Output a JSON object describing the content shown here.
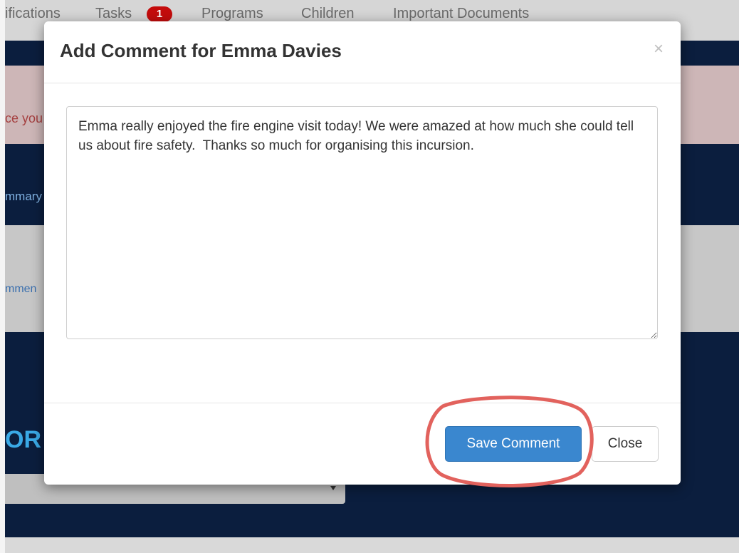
{
  "background": {
    "nav": {
      "items": [
        "ifications",
        "Tasks",
        "Programs",
        "Children",
        "Important Documents"
      ],
      "tasks_badge": "1"
    },
    "fragments": {
      "alert": "ce you",
      "summary_link": "mmary (",
      "comments_link": "mmen",
      "section_heading": "OR"
    }
  },
  "modal": {
    "title": "Add Comment for Emma Davies",
    "close_symbol": "×",
    "comment_text": "Emma really enjoyed the fire engine visit today! We were amazed at how much she could tell us about fire safety.  Thanks so much for organising this incursion.",
    "buttons": {
      "save": "Save Comment",
      "close": "Close"
    }
  },
  "colors": {
    "primary_button": "#3a87cf",
    "highlight_ring": "#e2625d",
    "navy_band": "#0b1e3e",
    "badge": "#c40c0c"
  }
}
